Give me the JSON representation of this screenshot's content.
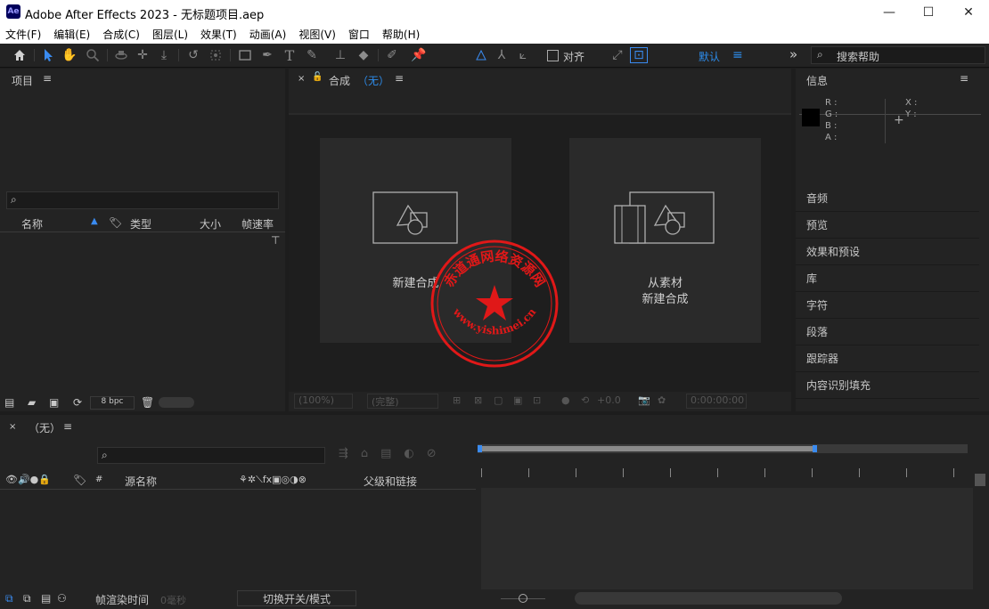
{
  "window": {
    "title": "Adobe After Effects 2023 - 无标题项目.aep",
    "logo": "Ae",
    "minimize": "—",
    "maximize": "☐",
    "close": "✕"
  },
  "menu": [
    "文件(F)",
    "编辑(E)",
    "合成(C)",
    "图层(L)",
    "效果(T)",
    "动画(A)",
    "视图(V)",
    "窗口",
    "帮助(H)"
  ],
  "toolbar": {
    "snap_label": "对齐",
    "workspace": "默认",
    "search_placeholder": "搜索帮助",
    "more": "»",
    "workspace_menu": "≡"
  },
  "project": {
    "title": "项目",
    "menu": "≡",
    "search_icon": "⌕",
    "columns": [
      "名称",
      "类型",
      "大小",
      "帧速率"
    ],
    "bpc": "8 bpc"
  },
  "comp": {
    "title": "合成",
    "name": "（无）",
    "menu": "≡",
    "new_comp": "新建合成",
    "from_footage_line1": "从素材",
    "from_footage_line2": "新建合成",
    "zoom": "(100%)",
    "resolution": "(完整)",
    "exposure": "+0.0",
    "timecode": "0:00:00:00"
  },
  "info": {
    "title": "信息",
    "menu": "≡",
    "r": "R :",
    "g": "G :",
    "b": "B :",
    "a": "A :",
    "x": "X :",
    "y": "Y :"
  },
  "side_panels": [
    "音频",
    "预览",
    "效果和预设",
    "库",
    "字符",
    "段落",
    "跟踪器",
    "内容识别填充"
  ],
  "timeline": {
    "title": "（无）",
    "menu": "≡",
    "source_name": "源名称",
    "parent": "父级和链接",
    "frame_render": "帧渲染时间",
    "frame_time": "0毫秒",
    "toggle": "切换开关/模式",
    "hash": "#"
  },
  "watermark": {
    "text_top": "赤道通网络资源网",
    "text_bottom": "www.yishimei.cn",
    "color": "#e01818"
  }
}
